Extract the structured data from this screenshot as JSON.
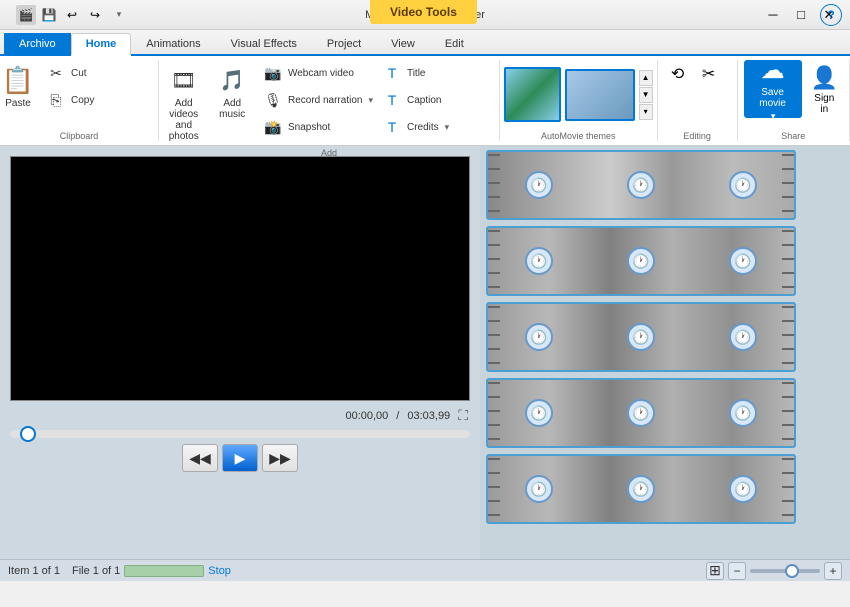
{
  "titleBar": {
    "title": "My Movie - Movie Maker",
    "videoToolsLabel": "Video Tools"
  },
  "windowControls": {
    "minimize": "─",
    "maximize": "□",
    "close": "✕"
  },
  "tabs": {
    "archivo": "Archivo",
    "home": "Home",
    "animations": "Animations",
    "visualEffects": "Visual Effects",
    "project": "Project",
    "view": "View",
    "edit": "Edit"
  },
  "clipboard": {
    "pasteLabel": "Paste",
    "cutLabel": "Cut",
    "copyLabel": "Copy",
    "groupLabel": "Clipboard"
  },
  "add": {
    "addVideosLabel": "Add videos\nand photos",
    "addMusicLabel": "Add\nmusic",
    "webcamLabel": "Webcam video",
    "recordNarrationLabel": "Record narration",
    "snapshotLabel": "Snapshot",
    "titleLabel": "Title",
    "captionLabel": "Caption",
    "creditsLabel": "Credits",
    "groupLabel": "Add"
  },
  "autoMovie": {
    "groupLabel": "AutoMovie themes"
  },
  "editing": {
    "groupLabel": "Editing"
  },
  "share": {
    "saveMovieLabel": "Save\nmovie",
    "signInLabel": "Sign\nin",
    "groupLabel": "Share"
  },
  "player": {
    "currentTime": "00:00,00",
    "totalTime": "03:03,99",
    "timeSeparator": "/"
  },
  "controls": {
    "prevFrame": "◀◀",
    "play": "▶",
    "nextFrame": "▶▶"
  },
  "statusBar": {
    "itemCount": "Item 1 of 1",
    "fileCount": "File 1 of 1",
    "stopLabel": "Stop"
  },
  "quickAccess": {
    "save": "💾",
    "undo": "↩",
    "redo": "↪",
    "dropdown": "▾"
  }
}
